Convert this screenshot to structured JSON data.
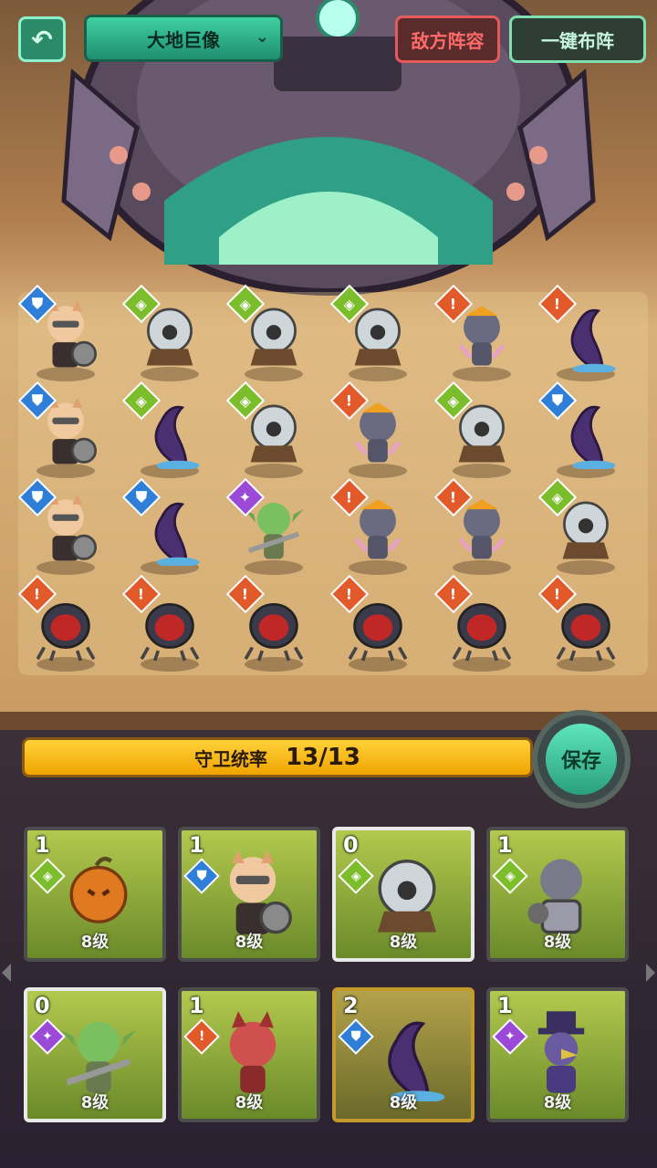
{
  "topbar": {
    "back_icon": "back-arrow-icon",
    "boss_name": "大地巨像",
    "boss_chevron": "double-chevron-down-icon",
    "enemy_lineup": "敌方阵容",
    "auto_deploy": "一键布阵"
  },
  "colors": {
    "defense": "#2f7fd8",
    "attack": "#e35a2a",
    "support": "#7bbd2a",
    "magic": "#9b4ad8",
    "accent_green": "#3fd0a0",
    "bar_yellow": "#ffd23a"
  },
  "board": {
    "units": [
      {
        "name": "cat-warrior",
        "badge": "defense"
      },
      {
        "name": "eyeball-turret",
        "badge": "support"
      },
      {
        "name": "eyeball-turret",
        "badge": "support"
      },
      {
        "name": "eyeball-turret",
        "badge": "support"
      },
      {
        "name": "dark-wolf",
        "badge": "attack"
      },
      {
        "name": "shadow-tentacle",
        "badge": "attack"
      },
      {
        "name": "cat-warrior",
        "badge": "defense"
      },
      {
        "name": "shadow-tentacle",
        "badge": "support"
      },
      {
        "name": "eyeball-turret",
        "badge": "support"
      },
      {
        "name": "dark-wolf",
        "badge": "attack"
      },
      {
        "name": "eyeball-turret",
        "badge": "support"
      },
      {
        "name": "shadow-tentacle",
        "badge": "defense"
      },
      {
        "name": "cat-warrior",
        "badge": "defense"
      },
      {
        "name": "shadow-tentacle",
        "badge": "defense"
      },
      {
        "name": "goblin-mechanic",
        "badge": "magic"
      },
      {
        "name": "dark-wolf",
        "badge": "attack"
      },
      {
        "name": "dark-wolf",
        "badge": "attack"
      },
      {
        "name": "eyeball-turret",
        "badge": "support"
      },
      {
        "name": "red-beetle",
        "badge": "attack"
      },
      {
        "name": "red-beetle",
        "badge": "attack"
      },
      {
        "name": "red-beetle",
        "badge": "attack"
      },
      {
        "name": "red-beetle",
        "badge": "attack"
      },
      {
        "name": "red-beetle",
        "badge": "attack"
      },
      {
        "name": "red-beetle",
        "badge": "attack"
      }
    ]
  },
  "guard": {
    "label": "守卫统率",
    "value": "13/13",
    "fill": 1.0
  },
  "save_button": "保存",
  "cards": [
    {
      "cost": "1",
      "badge": "support",
      "level": "8级",
      "unit": "pumpkin-brute"
    },
    {
      "cost": "1",
      "badge": "defense",
      "level": "8级",
      "unit": "cat-warrior"
    },
    {
      "cost": "0",
      "badge": "support",
      "level": "8级",
      "unit": "eyeball-turret",
      "selected": true
    },
    {
      "cost": "1",
      "badge": "support",
      "level": "8级",
      "unit": "armored-cat"
    },
    {
      "cost": "0",
      "badge": "magic",
      "level": "8级",
      "unit": "goblin-mechanic",
      "selected": true
    },
    {
      "cost": "1",
      "badge": "attack",
      "level": "8级",
      "unit": "red-wolf"
    },
    {
      "cost": "2",
      "badge": "defense",
      "level": "8级",
      "unit": "shadow-tentacle",
      "gold": true
    },
    {
      "cost": "1",
      "badge": "magic",
      "level": "8级",
      "unit": "crow-wizard"
    }
  ]
}
